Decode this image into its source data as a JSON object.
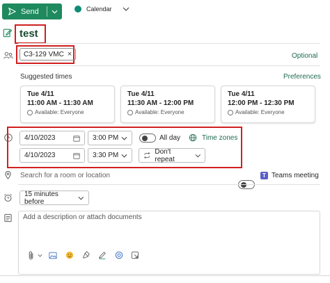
{
  "toolbar": {
    "send_label": "Send",
    "calendar_label": "Calendar"
  },
  "event": {
    "title": "test"
  },
  "attendees": {
    "chips": [
      {
        "label": "C3-129 VMC"
      }
    ],
    "optional_label": "Optional"
  },
  "suggested": {
    "heading": "Suggested times",
    "preferences_label": "Preferences",
    "cards": [
      {
        "day": "Tue 4/11",
        "time": "11:00 AM - 11:30 AM",
        "availability": "Available: Everyone"
      },
      {
        "day": "Tue 4/11",
        "time": "11:30 AM - 12:00 PM",
        "availability": "Available: Everyone"
      },
      {
        "day": "Tue 4/11",
        "time": "12:00 PM - 12:30 PM",
        "availability": "Available: Everyone"
      }
    ]
  },
  "datetime": {
    "start_date": "4/10/2023",
    "start_time": "3:00 PM",
    "end_date": "4/10/2023",
    "end_time": "3:30 PM",
    "all_day_label": "All day",
    "all_day_on": false,
    "time_zones_label": "Time zones",
    "repeat_label": "Don't repeat"
  },
  "location": {
    "placeholder": "Search for a room or location",
    "teams_label": "Teams meeting",
    "teams_on": false
  },
  "reminder": {
    "value": "15 minutes before"
  },
  "description": {
    "placeholder": "Add a description or attach documents"
  },
  "colors": {
    "accent": "#1e8a5e",
    "highlight": "#d11f1f",
    "link": "#1e6b4e",
    "teams": "#5b5fc7"
  }
}
